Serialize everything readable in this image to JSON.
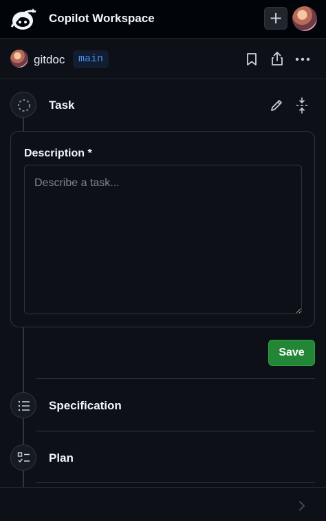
{
  "header": {
    "app_title": "Copilot Workspace",
    "new_button_label": "+",
    "icons": [
      "copilot-logo-icon",
      "plus-icon",
      "user-avatar"
    ]
  },
  "repo": {
    "name": "gitdoc",
    "branch": "main",
    "actions": [
      "bookmark-icon",
      "share-icon",
      "more-options-icon"
    ]
  },
  "steps": {
    "task": {
      "label": "Task",
      "icons": [
        "task-status-icon",
        "edit-pencil-icon",
        "collapse-icon"
      ]
    },
    "description": {
      "label": "Description *",
      "placeholder": "Describe a task...",
      "value": ""
    },
    "save_label": "Save",
    "specification": {
      "label": "Specification",
      "icon": "list-icon"
    },
    "plan": {
      "label": "Plan",
      "icon": "checklist-icon"
    }
  },
  "footer": {
    "icon": "chevron-right-icon"
  },
  "colors": {
    "background": "#0d1117",
    "topbar": "#010409",
    "border": "#30363d",
    "accent_blue": "#4493f8",
    "save_green": "#238636"
  }
}
